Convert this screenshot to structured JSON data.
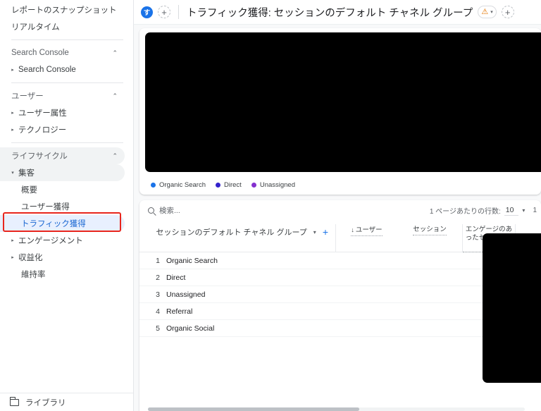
{
  "sidebar": {
    "items": [
      {
        "label": "レポートのスナップショット",
        "type": "top"
      },
      {
        "label": "リアルタイム",
        "type": "top"
      },
      {
        "label": "Search Console",
        "type": "section",
        "caret": "⌃"
      },
      {
        "label": "Search Console",
        "type": "child",
        "arrow": "▸"
      },
      {
        "label": "ユーザー",
        "type": "section",
        "caret": "⌃"
      },
      {
        "label": "ユーザー属性",
        "type": "child",
        "arrow": "▸"
      },
      {
        "label": "テクノロジー",
        "type": "child",
        "arrow": "▸"
      },
      {
        "label": "ライフサイクル",
        "type": "section",
        "caret": "⌃"
      },
      {
        "label": "集客",
        "type": "child-expanded",
        "arrow": "▾"
      },
      {
        "label": "概要",
        "type": "grandchild"
      },
      {
        "label": "ユーザー獲得",
        "type": "grandchild"
      },
      {
        "label": "トラフィック獲得",
        "type": "grandchild-selected"
      },
      {
        "label": "エンゲージメント",
        "type": "child",
        "arrow": "▸"
      },
      {
        "label": "収益化",
        "type": "child",
        "arrow": "▸"
      },
      {
        "label": "維持率",
        "type": "grandchild"
      }
    ],
    "library": {
      "label": "ライブラリ",
      "icon": "library-folder-icon"
    }
  },
  "topbar": {
    "badge_text": "す",
    "badge_color": "#1a73e8",
    "add_left_label": "+",
    "title": "トラフィック獲得: セッションのデフォルト チャネル グループ",
    "warning_icon": "⚠",
    "warning_color": "#e37400",
    "warning_caret": "▾",
    "add_right_label": "+"
  },
  "chart": {
    "redacted": true,
    "legend": [
      {
        "label": "Organic Search",
        "color": "#1a73e8"
      },
      {
        "label": "Direct",
        "color": "#3322cc"
      },
      {
        "label": "Unassigned",
        "color": "#8430ce"
      }
    ]
  },
  "table": {
    "search": {
      "placeholder": "検索...",
      "value": "",
      "icon": "search-icon"
    },
    "rows_per_page_label": "1 ページあたりの行数:",
    "rows_per_page_value": "10",
    "rows_per_page_caret": "▾",
    "page_range": "1",
    "dimension_header": {
      "label": "セッションのデフォルト チャネル グループ",
      "caret": "▾",
      "add": "+"
    },
    "metric_headers": [
      {
        "label": "ユーザー",
        "sort": "↓",
        "redacted": true
      },
      {
        "label": "セッション",
        "sort": "",
        "redacted": true
      },
      {
        "label": "エンゲージのあったセッション数",
        "sort": "",
        "redacted": true,
        "highlighted": true
      },
      {
        "label": "",
        "sort": "",
        "redacted": true
      }
    ],
    "rows": [
      {
        "num": "1",
        "name": "Organic Search"
      },
      {
        "num": "2",
        "name": "Direct"
      },
      {
        "num": "3",
        "name": "Unassigned"
      },
      {
        "num": "4",
        "name": "Referral"
      },
      {
        "num": "5",
        "name": "Organic Social"
      }
    ]
  },
  "annotations": {
    "highlight_color": "#e8261d",
    "sidebar_highlight_target": "トラフィック獲得",
    "table_highlight_target": "エンゲージのあったセッション数"
  }
}
